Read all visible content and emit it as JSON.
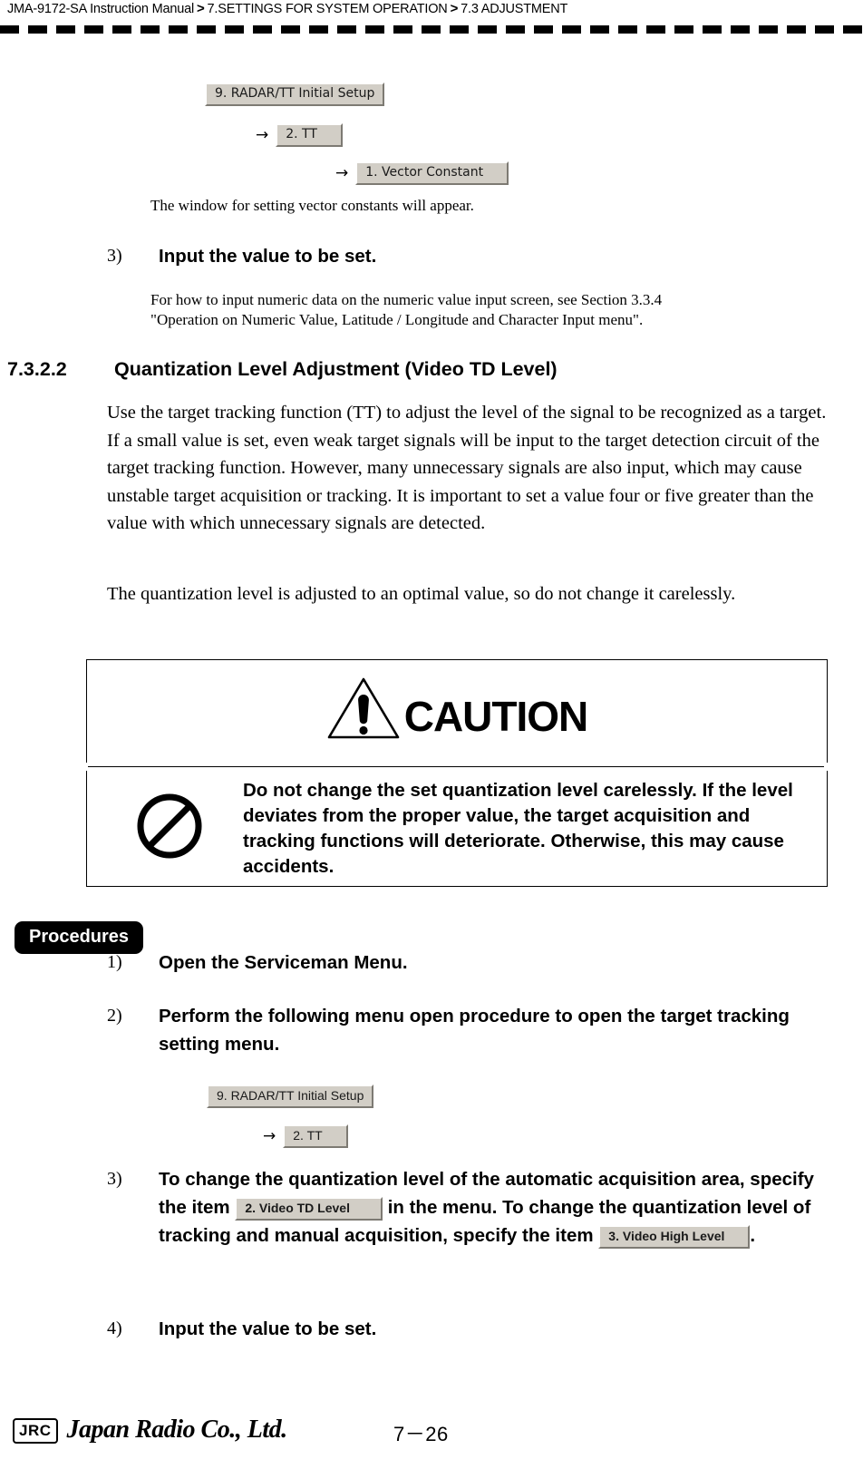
{
  "header": {
    "manual": "JMA-9172-SA Instruction Manual",
    "separator": ">",
    "chapter": "7.SETTINGS FOR SYSTEM OPERATION",
    "section": "7.3  ADJUSTMENT"
  },
  "menu_chain_top": {
    "item1": "9. RADAR/TT Initial Setup",
    "item2": "2. TT",
    "item3": "1. Vector Constant",
    "arrow": "→"
  },
  "intro": {
    "result_text": "The window for setting vector constants will appear."
  },
  "step_prev": {
    "number": "3)",
    "title": "Input the value to be set.",
    "note_line1": "For how to input numeric data on the numeric value input screen, see Section 3.3.4",
    "note_line2": "\"Operation on Numeric Value, Latitude / Longitude and Character Input menu\"."
  },
  "section": {
    "number": "7.3.2.2",
    "title": "Quantization Level Adjustment (Video TD Level)",
    "paragraph1": "Use the target tracking function (TT) to adjust the level of the signal to be recognized as a target. If a small value is set, even weak target signals will be input to the target detection circuit of the target tracking function. However, many unnecessary signals are also input, which may cause unstable target acquisition or tracking. It is important to set a value four or five greater than the value with which unnecessary signals are detected.",
    "paragraph2": "The quantization level is adjusted to an optimal value, so do not change it carelessly."
  },
  "caution": {
    "title": "CAUTION",
    "body": "Do not change the set quantization level carelessly. If the level deviates from the proper value, the target acquisition and tracking functions will deteriorate. Otherwise, this may cause accidents.",
    "warning_icon_name": "warning-triangle-icon",
    "prohibit_icon_name": "prohibition-icon"
  },
  "procedures": {
    "tab_label": "Procedures",
    "steps": [
      {
        "number": "1)",
        "title": "Open the Serviceman Menu."
      },
      {
        "number": "2)",
        "title": "Perform the following menu open procedure to open the target tracking setting menu."
      },
      {
        "number": "3)",
        "title_part1": "To change the quantization level of the automatic acquisition area, specify the item",
        "chip1": "2. Video TD Level",
        "title_part2": "in the menu. To change the quantization level of tracking and manual acquisition, specify the item",
        "chip2": "3. Video High Level",
        "title_part3": "."
      },
      {
        "number": "4)",
        "title": "Input the value to be set."
      }
    ],
    "menu_chain": {
      "item1": "9. RADAR/TT Initial Setup",
      "item2": "2. TT",
      "arrow": "→"
    }
  },
  "footer": {
    "logo": "JRC",
    "company": "Japan Radio Co., Ltd.",
    "page": "7－26"
  },
  "colors": {
    "chip_face": "#d2cec6",
    "chip_light": "#ffffff",
    "chip_shadow": "#7d7a73",
    "ink": "#000000",
    "paper": "#ffffff"
  }
}
